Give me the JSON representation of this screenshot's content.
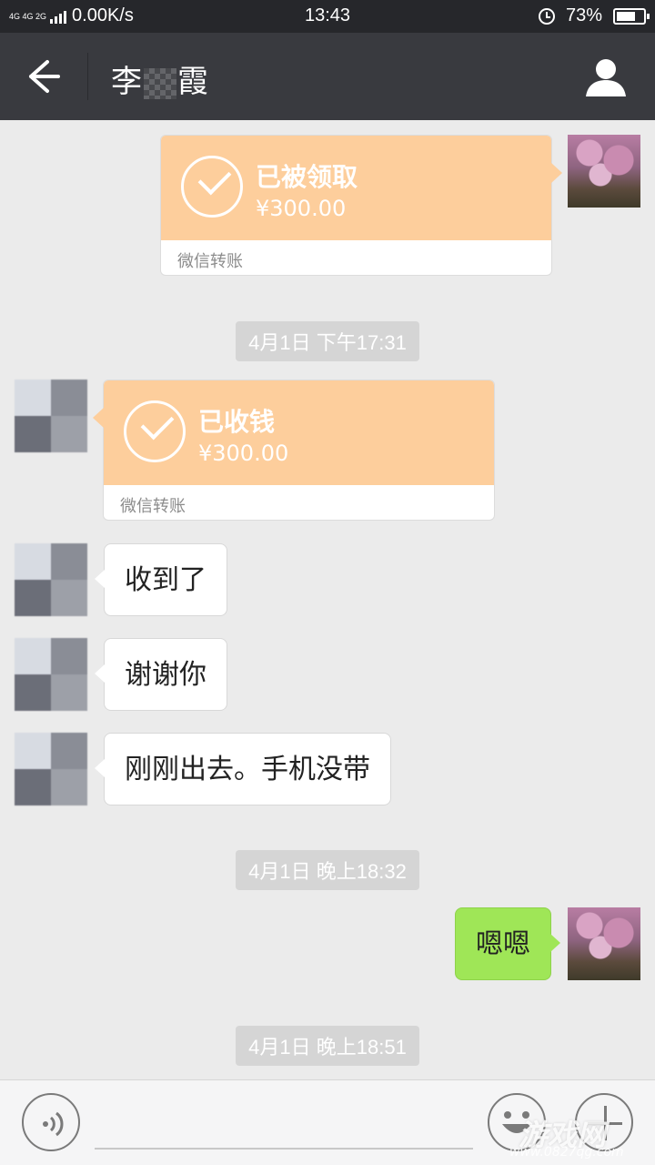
{
  "status_bar": {
    "network_label": "4G 4G 2G",
    "speed": "0.00K/s",
    "time": "13:43",
    "battery": "73%",
    "battery_level": 0.73
  },
  "header": {
    "title_first": "李",
    "title_last": "霞"
  },
  "messages": {
    "transfer_sent": {
      "status": "已被领取",
      "amount": "¥300.00",
      "footer": "微信转账"
    },
    "time1": "4月1日 下午17:31",
    "transfer_received": {
      "status": "已收钱",
      "amount": "¥300.00",
      "footer": "微信转账"
    },
    "msg1": "收到了",
    "msg2": "谢谢你",
    "msg3": "刚刚出去。手机没带",
    "time2": "4月1日 晚上18:32",
    "msg4": "嗯嗯",
    "time3": "4月1日 晚上18:51"
  },
  "watermark": {
    "text": "游戏网",
    "url": "www.0827qg.com"
  },
  "colors": {
    "header_bg": "#393a3f",
    "transfer_orange": "#fdce9c",
    "outgoing_bubble": "#9fe657",
    "chat_bg": "#ebebeb"
  }
}
